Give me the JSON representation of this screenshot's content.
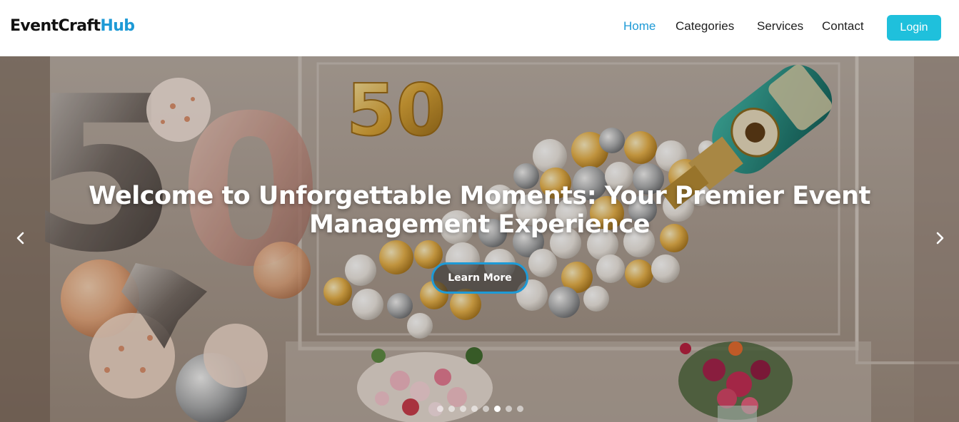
{
  "brand": {
    "part1": "EventCraft",
    "part2": "Hub"
  },
  "nav": {
    "items": [
      {
        "label": "Home",
        "active": true
      },
      {
        "label": "Categories",
        "active": false
      },
      {
        "label": "Services",
        "active": false
      },
      {
        "label": "Contact",
        "active": false
      }
    ],
    "login_label": "Login"
  },
  "hero": {
    "title": "Welcome to Unforgettable Moments: Your Premier Event Management Experience",
    "cta_label": "Learn More",
    "prev_icon": "chevron-left-icon",
    "next_icon": "chevron-right-icon",
    "slides_count": 8,
    "active_slide": 5
  },
  "colors": {
    "accent": "#1e9ad6",
    "login_bg": "#1fc0dc"
  }
}
